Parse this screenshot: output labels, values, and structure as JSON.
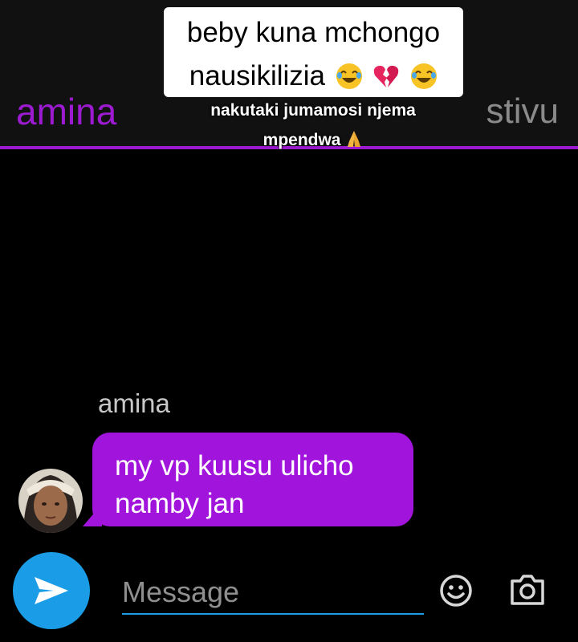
{
  "header": {
    "left_name": "amina",
    "right_name": "stivu"
  },
  "overlay": {
    "caption_line1": "beby kuna mchongo",
    "caption_line2": "nausikilizia",
    "caption_emojis": [
      "joy-emoji",
      "broken-heart-emoji",
      "joy-emoji"
    ],
    "subtitle_line1": "nakutaki jumamosi njema",
    "subtitle_line2": "mpendwa",
    "subtitle_emoji": "praying-hands-emoji"
  },
  "chat": {
    "sender": "amina",
    "message_line1": "my vp kuusu ulicho",
    "message_line2": "namby jan"
  },
  "composer": {
    "placeholder": "Message"
  },
  "colors": {
    "accent_purple": "#9c1ad0",
    "bubble_purple": "#a114dc",
    "send_blue": "#1a9ce6"
  }
}
